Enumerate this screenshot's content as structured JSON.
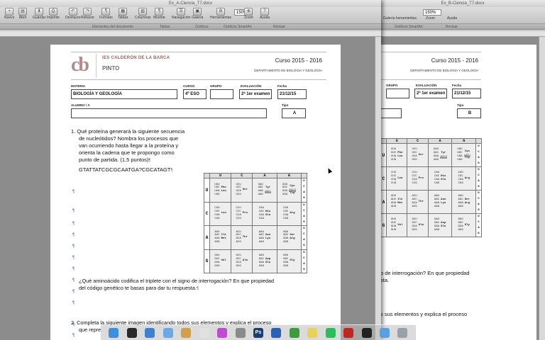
{
  "back_window": {
    "title": "Ex_B-Ciencia_T7.docx",
    "zoom": "150%",
    "tools": [
      "Galería herramientas",
      "Zoom",
      "Ayuda"
    ],
    "ribbon": [
      "Gráficos SmartArt",
      "Revisar"
    ],
    "header": {
      "course": "Curso 2015 - 2016",
      "dept": "DEPARTAMENTO DE BIOLOGÍA Y GEOLOGÍA"
    },
    "fields": {
      "grupo_label": "GRUPO",
      "evaluacion_label": "EVALUACIÓN",
      "evaluacion": "2ª 1er examen",
      "fecha_label": "Fecha",
      "fecha": "21/12/15",
      "tipo_label": "Tipo",
      "tipo": "B"
    },
    "question_fragment": "o de interrogación? En que propiedad",
    "question_fragment2": "sta.",
    "question3_fragment": "s sus elementos y explica el proceso"
  },
  "front_window": {
    "title": "Ex_A-Ciencia_T7.docx",
    "zoom": "150%",
    "tools": [
      "Nuevo",
      "Abrir",
      "Guardar",
      "Imprimir",
      "Deshacer",
      "Rehacer",
      "Formato",
      "Tablas",
      "Columnas",
      "Mostrar",
      "Navegación",
      "Galería",
      "Herramientas",
      "Zoom",
      "Ayuda"
    ],
    "ribbon": [
      "Elementos del documento",
      "Tablas",
      "Gráficos",
      "Gráficos SmartArt",
      "Revisar"
    ],
    "header": {
      "logo": "cb",
      "school": "IES CALDERÓN DE LA BARCA",
      "town": "PINTO",
      "course": "Curso 2015 - 2016",
      "dept": "DEPARTAMENTO DE BIOLOGÍA Y GEOLOGÍA"
    },
    "fields": {
      "materia_label": "MATERIA",
      "materia": "BIOLOGÍA Y GEOLOGÍA",
      "curso_label": "CURSO",
      "curso": "4º ESO",
      "grupo_label": "GRUPO",
      "grupo": "",
      "evaluacion_label": "EVALUACIÓN",
      "evaluacion": "2ª 1er examen",
      "fecha_label": "Fecha",
      "fecha": "21/12/15",
      "alumno_label": "ALUMNO / A",
      "alumno": "",
      "tipo_label": "Tipo",
      "tipo": "A"
    },
    "question1": {
      "number": "1.",
      "line1": "Qué proteína generará la siguiente secuencia",
      "line2": "de nucleótidos? Nombra los procesos que",
      "line3": "van ocurriendo hasta llegar a la proteína y",
      "line4": "orienta la cadena que te propongo como",
      "line5": "punto de partida. (1,5 puntos)",
      "sequence": "GTATTATCGCGCAATGA?CGCATAGT"
    },
    "question1b": {
      "line1": "¿Qué aminoácido codifica el triplete con el signo de interrogación? En que propiedad",
      "line2": "del código genético te basas para dar tu respuesta."
    },
    "question2": {
      "number": "2.",
      "line1": "Completa la siguiente imagen identificando todos sus elementos y explica el proceso",
      "line2": "que repre"
    },
    "pilcrow": "¶"
  },
  "genetic_code": {
    "columns": [
      "U",
      "C",
      "A",
      "G"
    ],
    "rows": [
      {
        "base": "U",
        "cells": [
          {
            "codons": [
              "UUU",
              "UUC",
              "UUA",
              "UUG"
            ],
            "aa": [
              "Phe",
              "Leu"
            ]
          },
          {
            "codons": [
              "UCU",
              "UCC",
              "UCA",
              "UCG"
            ],
            "aa": [
              "Ser"
            ]
          },
          {
            "codons": [
              "UAU",
              "UAC",
              "UAA",
              "UAG"
            ],
            "aa": [
              "Tyr",
              "Stop"
            ]
          },
          {
            "codons": [
              "UGU",
              "UGC",
              "UGA",
              "UGG"
            ],
            "aa": [
              "Cys",
              "Stop",
              "Trp"
            ]
          }
        ],
        "third": [
          "U",
          "C",
          "A",
          "G"
        ]
      },
      {
        "base": "C",
        "cells": [
          {
            "codons": [
              "CUU",
              "CUC",
              "CUA",
              "CUG"
            ],
            "aa": [
              "Leu"
            ]
          },
          {
            "codons": [
              "CCU",
              "CCC",
              "CCA",
              "CCG"
            ],
            "aa": [
              "Pro"
            ]
          },
          {
            "codons": [
              "CAU",
              "CAC",
              "CAA",
              "CAG"
            ],
            "aa": [
              "His",
              "Gln"
            ]
          },
          {
            "codons": [
              "CGU",
              "CGC",
              "CGA",
              "CGG"
            ],
            "aa": [
              "Arg"
            ]
          }
        ],
        "third": [
          "U",
          "C",
          "A",
          "G"
        ]
      },
      {
        "base": "A",
        "cells": [
          {
            "codons": [
              "AUU",
              "AUC",
              "AUA",
              "AUG"
            ],
            "aa": [
              "Ile",
              "Met"
            ]
          },
          {
            "codons": [
              "ACU",
              "ACC",
              "ACA",
              "ACG"
            ],
            "aa": [
              "Thr"
            ]
          },
          {
            "codons": [
              "AAU",
              "AAC",
              "AAA",
              "AAG"
            ],
            "aa": [
              "Asn",
              "Lys"
            ]
          },
          {
            "codons": [
              "AGU",
              "AGC",
              "AGA",
              "AGG"
            ],
            "aa": [
              "Ser",
              "Arg"
            ]
          }
        ],
        "third": [
          "U",
          "C",
          "A",
          "G"
        ]
      },
      {
        "base": "G",
        "cells": [
          {
            "codons": [
              "GUU",
              "GUC",
              "GUA",
              "GUG"
            ],
            "aa": [
              "Val"
            ]
          },
          {
            "codons": [
              "GCU",
              "GCC",
              "GCA",
              "GCG"
            ],
            "aa": [
              "Ala"
            ]
          },
          {
            "codons": [
              "GAU",
              "GAC",
              "GAA",
              "GAG"
            ],
            "aa": [
              "Asp",
              "Glu"
            ]
          },
          {
            "codons": [
              "GGU",
              "GGC",
              "GGA",
              "GGG"
            ],
            "aa": [
              "Gly"
            ]
          }
        ],
        "third": [
          "U",
          "C",
          "A",
          "G"
        ]
      }
    ]
  },
  "dock": {
    "apps": [
      "Finder",
      "Dashboard",
      "Safari",
      "Mail",
      "Fotos",
      "Calendario",
      "iTunes",
      "Preferencias",
      "Ps",
      "Word",
      "Hoja",
      "Notas",
      "Spotify",
      "Acrobat",
      "Terminal",
      "Carpeta",
      "Papelera"
    ],
    "ps_label": "Ps"
  }
}
